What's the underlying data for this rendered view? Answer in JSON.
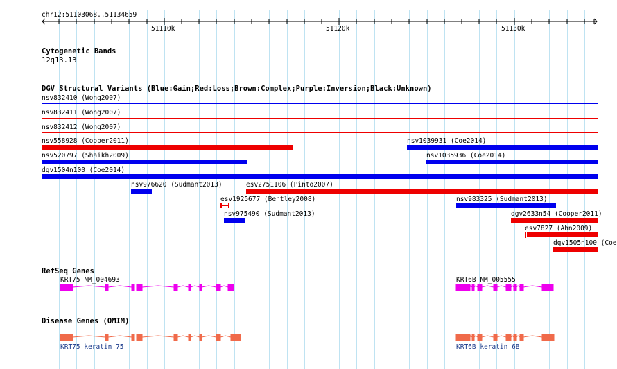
{
  "ruler": {
    "location": "chr12:51103068..51134659",
    "ticks": [
      "51110k",
      "51120k",
      "51130k"
    ]
  },
  "cytogenetic": {
    "title": "Cytogenetic Bands",
    "band": "12q13.13"
  },
  "dgv": {
    "title": "DGV Structural Variants (Blue:Gain;Red:Loss;Brown:Complex;Purple:Inversion;Black:Unknown)",
    "variants": [
      {
        "label": "nsv832410 (Wong2007)",
        "type": "gain"
      },
      {
        "label": "nsv832411 (Wong2007)",
        "type": "loss"
      },
      {
        "label": "nsv832412 (Wong2007)",
        "type": "loss"
      },
      {
        "label": "nsv558928 (Cooper2011)",
        "type": "loss"
      },
      {
        "label": "nsv1039931 (Coe2014)",
        "type": "gain"
      },
      {
        "label": "nsv520797 (Shaikh2009)",
        "type": "gain"
      },
      {
        "label": "nsv1035936 (Coe2014)",
        "type": "gain"
      },
      {
        "label": "dgv1504n100 (Coe2014)",
        "type": "gain"
      },
      {
        "label": "nsv976620 (Sudmant2013)",
        "type": "gain"
      },
      {
        "label": "esv2751106 (Pinto2007)",
        "type": "loss"
      },
      {
        "label": "esv1925677 (Bentley2008)",
        "type": "loss"
      },
      {
        "label": "nsv983325 (Sudmant2013)",
        "type": "gain"
      },
      {
        "label": "nsv975490 (Sudmant2013)",
        "type": "gain"
      },
      {
        "label": "dgv2633n54 (Cooper2011)",
        "type": "loss"
      },
      {
        "label": "esv7827 (Ahn2009)",
        "type": "loss"
      },
      {
        "label": "dgv1505n100 (Coe",
        "type": "loss"
      }
    ]
  },
  "refseq": {
    "title": "RefSeq Genes",
    "genes": [
      "KRT75|NM_004693",
      "KRT6B|NM_005555"
    ]
  },
  "disease": {
    "title": "Disease Genes (OMIM)",
    "genes": [
      "KRT75|keratin 75",
      "KRT6B|keratin 6B"
    ]
  },
  "colors": {
    "gain": "#0000ee",
    "loss": "#ee0000",
    "refseq": "#ee00ee",
    "disease": "#f06a4a",
    "grid": "#bfe3f2"
  }
}
